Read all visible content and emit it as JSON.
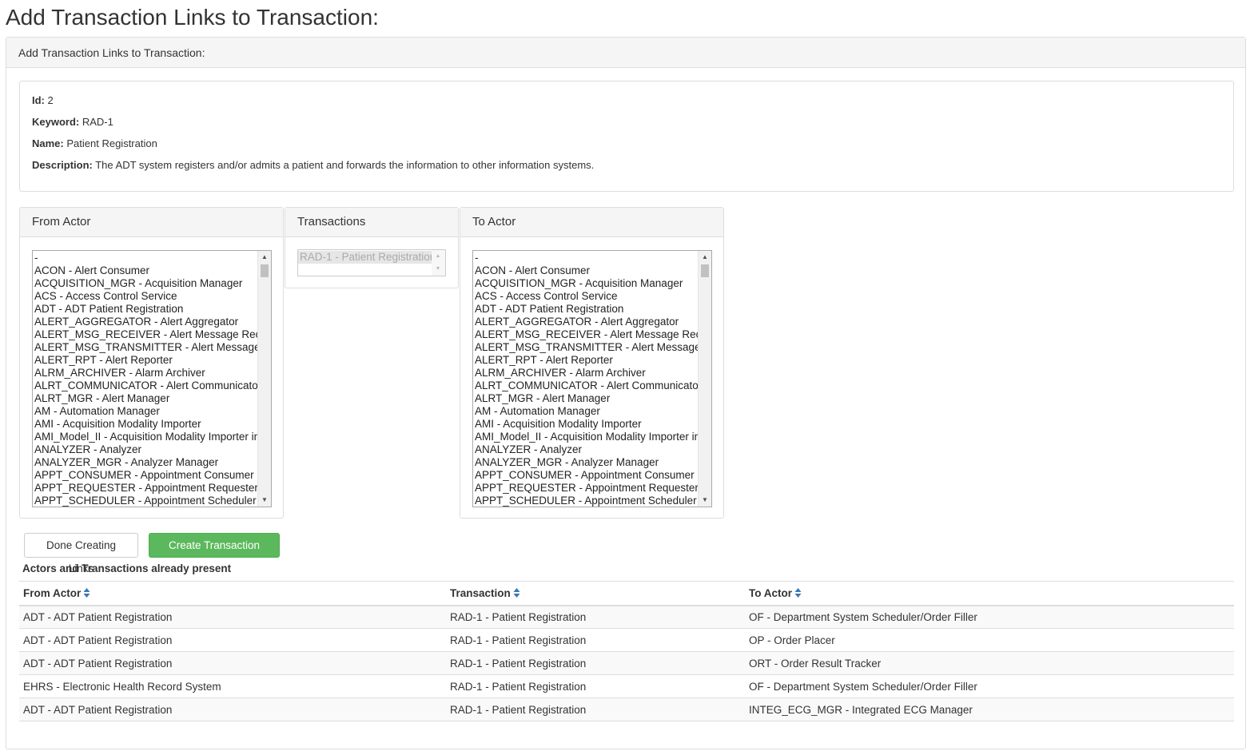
{
  "page": {
    "title": "Add Transaction Links to Transaction:"
  },
  "panel": {
    "heading": "Add Transaction Links to Transaction:"
  },
  "transaction": {
    "id_label": "Id:",
    "id_value": "2",
    "keyword_label": "Keyword:",
    "keyword_value": "RAD-1",
    "name_label": "Name:",
    "name_value": "Patient Registration",
    "description_label": "Description:",
    "description_value": "The ADT system registers and/or admits a patient and forwards the information to other information systems."
  },
  "from_actor": {
    "heading": "From Actor",
    "options": [
      "-",
      "ACON - Alert Consumer",
      "ACQUISITION_MGR - Acquisition Manager",
      "ACS - Access Control Service",
      "ADT - ADT Patient Registration",
      "ALERT_AGGREGATOR - Alert Aggregator",
      "ALERT_MSG_RECEIVER - Alert Message Rece",
      "ALERT_MSG_TRANSMITTER - Alert Message T",
      "ALERT_RPT - Alert Reporter",
      "ALRM_ARCHIVER - Alarm Archiver",
      "ALRT_COMMUNICATOR - Alert Communicator",
      "ALRT_MGR - Alert Manager",
      "AM - Automation Manager",
      "AMI - Acquisition Modality Importer",
      "AMI_Model_II - Acquisition Modality Importer in U",
      "ANALYZER - Analyzer",
      "ANALYZER_MGR - Analyzer Manager",
      "APPT_CONSUMER - Appointment Consumer",
      "APPT_REQUESTER - Appointment Requester",
      "APPT_SCHEDULER - Appointment Scheduler"
    ]
  },
  "transactions": {
    "heading": "Transactions",
    "options": [
      "RAD-1 - Patient Registration"
    ]
  },
  "to_actor": {
    "heading": "To Actor",
    "options": [
      "-",
      "ACON - Alert Consumer",
      "ACQUISITION_MGR - Acquisition Manager",
      "ACS - Access Control Service",
      "ADT - ADT Patient Registration",
      "ALERT_AGGREGATOR - Alert Aggregator",
      "ALERT_MSG_RECEIVER - Alert Message Rece",
      "ALERT_MSG_TRANSMITTER - Alert Message T",
      "ALERT_RPT - Alert Reporter",
      "ALRM_ARCHIVER - Alarm Archiver",
      "ALRT_COMMUNICATOR - Alert Communicator",
      "ALRT_MGR - Alert Manager",
      "AM - Automation Manager",
      "AMI - Acquisition Modality Importer",
      "AMI_Model_II - Acquisition Modality Importer in U",
      "ANALYZER - Analyzer",
      "ANALYZER_MGR - Analyzer Manager",
      "APPT_CONSUMER - Appointment Consumer",
      "APPT_REQUESTER - Appointment Requester",
      "APPT_SCHEDULER - Appointment Scheduler"
    ]
  },
  "buttons": {
    "done_label": "Done Creating Links",
    "create_label": "Create Transaction Link"
  },
  "existing": {
    "title": "Actors and Transactions already present",
    "columns": [
      "From Actor",
      "Transaction",
      "To Actor"
    ],
    "rows": [
      [
        "ADT - ADT Patient Registration",
        "RAD-1 - Patient Registration",
        "OF - Department System Scheduler/Order Filler"
      ],
      [
        "ADT - ADT Patient Registration",
        "RAD-1 - Patient Registration",
        "OP - Order Placer"
      ],
      [
        "ADT - ADT Patient Registration",
        "RAD-1 - Patient Registration",
        "ORT - Order Result Tracker"
      ],
      [
        "EHRS - Electronic Health Record System",
        "RAD-1 - Patient Registration",
        "OF - Department System Scheduler/Order Filler"
      ],
      [
        "ADT - ADT Patient Registration",
        "RAD-1 - Patient Registration",
        "INTEG_ECG_MGR - Integrated ECG Manager"
      ]
    ]
  },
  "icons": {
    "sort": "sort-icon",
    "scroll_up": "scroll-up-arrow-icon",
    "scroll_down": "scroll-down-arrow-icon"
  },
  "colors": {
    "success_button": "#5cb85c",
    "sort_icon": "#3a78b5",
    "panel_heading_bg": "#f5f5f5"
  }
}
